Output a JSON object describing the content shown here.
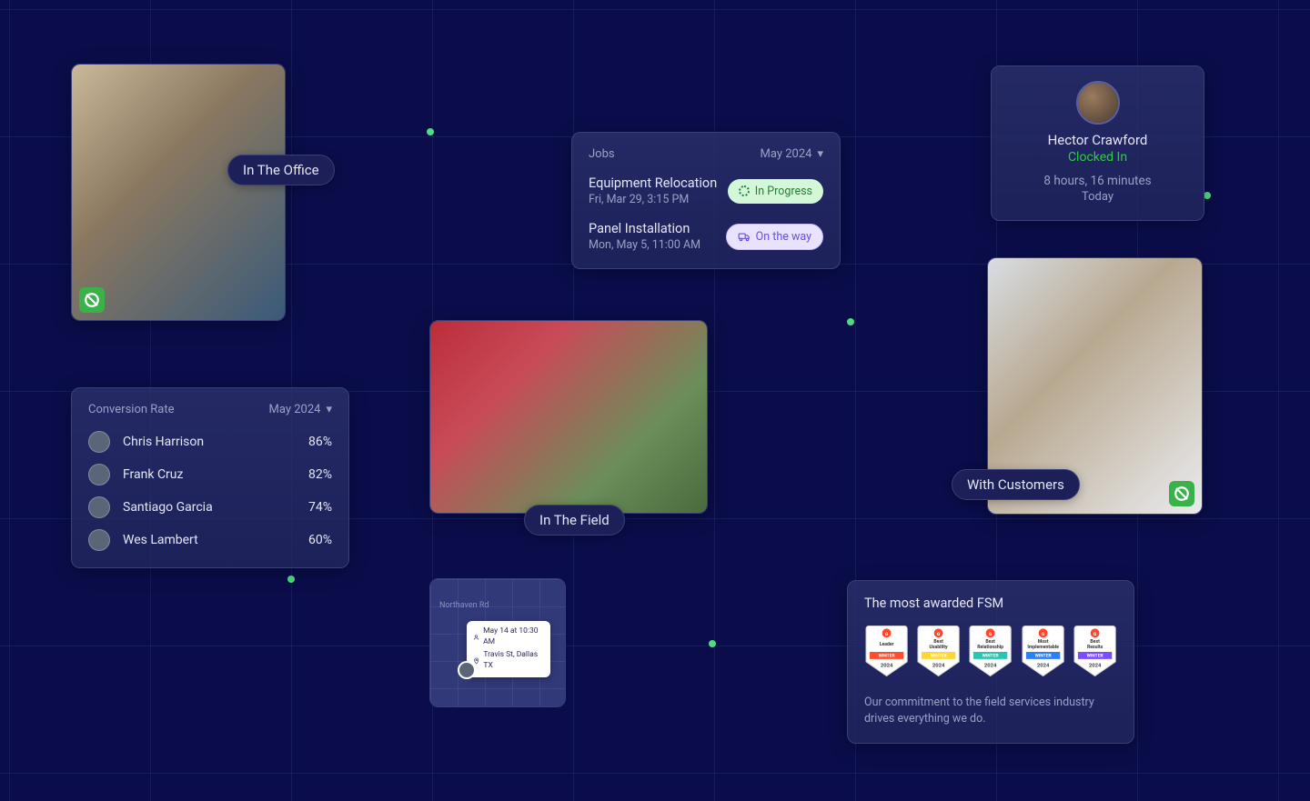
{
  "tags": {
    "office": "In The Office",
    "field": "In The Field",
    "customers": "With Customers"
  },
  "jobs": {
    "header": "Jobs",
    "period": "May 2024",
    "items": [
      {
        "title": "Equipment Relocation",
        "sub": "Fri, Mar 29, 3:15 PM",
        "status": "In Progress",
        "kind": "progress"
      },
      {
        "title": "Panel Installation",
        "sub": "Mon, May 5, 11:00 AM",
        "status": "On the way",
        "kind": "onway"
      }
    ]
  },
  "clock": {
    "name": "Hector Crawford",
    "status": "Clocked In",
    "hours": "8 hours, 16 minutes",
    "today": "Today"
  },
  "conversion": {
    "header": "Conversion Rate",
    "period": "May 2024",
    "rows": [
      {
        "name": "Chris Harrison",
        "val": "86%"
      },
      {
        "name": "Frank Cruz",
        "val": "82%"
      },
      {
        "name": "Santiago Garcia",
        "val": "74%"
      },
      {
        "name": "Wes Lambert",
        "val": "60%"
      }
    ]
  },
  "map": {
    "road": "Northaven Rd",
    "time": "May 14 at 10:30 AM",
    "addr": "Travis St, Dallas TX"
  },
  "awards": {
    "title": "The most awarded FSM",
    "sub": "Our commitment to the field services industry drives everything we do.",
    "badges": [
      {
        "top": "G2",
        "line1": "Leader",
        "bar": "WINTER",
        "barColor": "#ff4d2e",
        "year": "2024"
      },
      {
        "top": "G2",
        "line1": "Best",
        "line2": "Usability",
        "bar": "WINTER",
        "barColor": "#ffd633",
        "year": "2024"
      },
      {
        "top": "G2",
        "line1": "Best",
        "line2": "Relationship",
        "bar": "WINTER",
        "barColor": "#2bc4b2",
        "year": "2024"
      },
      {
        "top": "G2",
        "line1": "Most",
        "line2": "Implementable",
        "bar": "WINTER",
        "barColor": "#2d7ff9",
        "year": "2024"
      },
      {
        "top": "G2",
        "line1": "Best",
        "line2": "Results",
        "bar": "WINTER",
        "barColor": "#7b4dff",
        "year": "2024"
      }
    ]
  }
}
